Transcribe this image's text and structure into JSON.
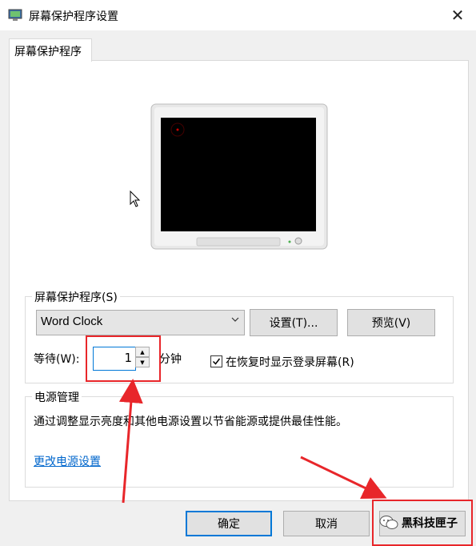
{
  "window": {
    "title": "屏幕保护程序设置"
  },
  "tabs": [
    {
      "label": "屏幕保护程序"
    }
  ],
  "screensaver": {
    "group_label": "屏幕保护程序(S)",
    "selected": "Word Clock",
    "settings_button": "设置(T)...",
    "preview_button": "预览(V)",
    "wait_label": "等待(W):",
    "wait_value": "1",
    "minutes_label": "分钟",
    "resume_checkbox_label": "在恢复时显示登录屏幕(R)",
    "resume_checked": true
  },
  "power": {
    "group_label": "电源管理",
    "description": "通过调整显示亮度和其他电源设置以节省能源或提供最佳性能。",
    "link": "更改电源设置"
  },
  "footer": {
    "ok": "确定",
    "cancel": "取消",
    "apply_watermark": "黑科技匣子"
  },
  "colors": {
    "accent": "#0078d7",
    "highlight": "#e8262a",
    "link": "#0066cc"
  }
}
